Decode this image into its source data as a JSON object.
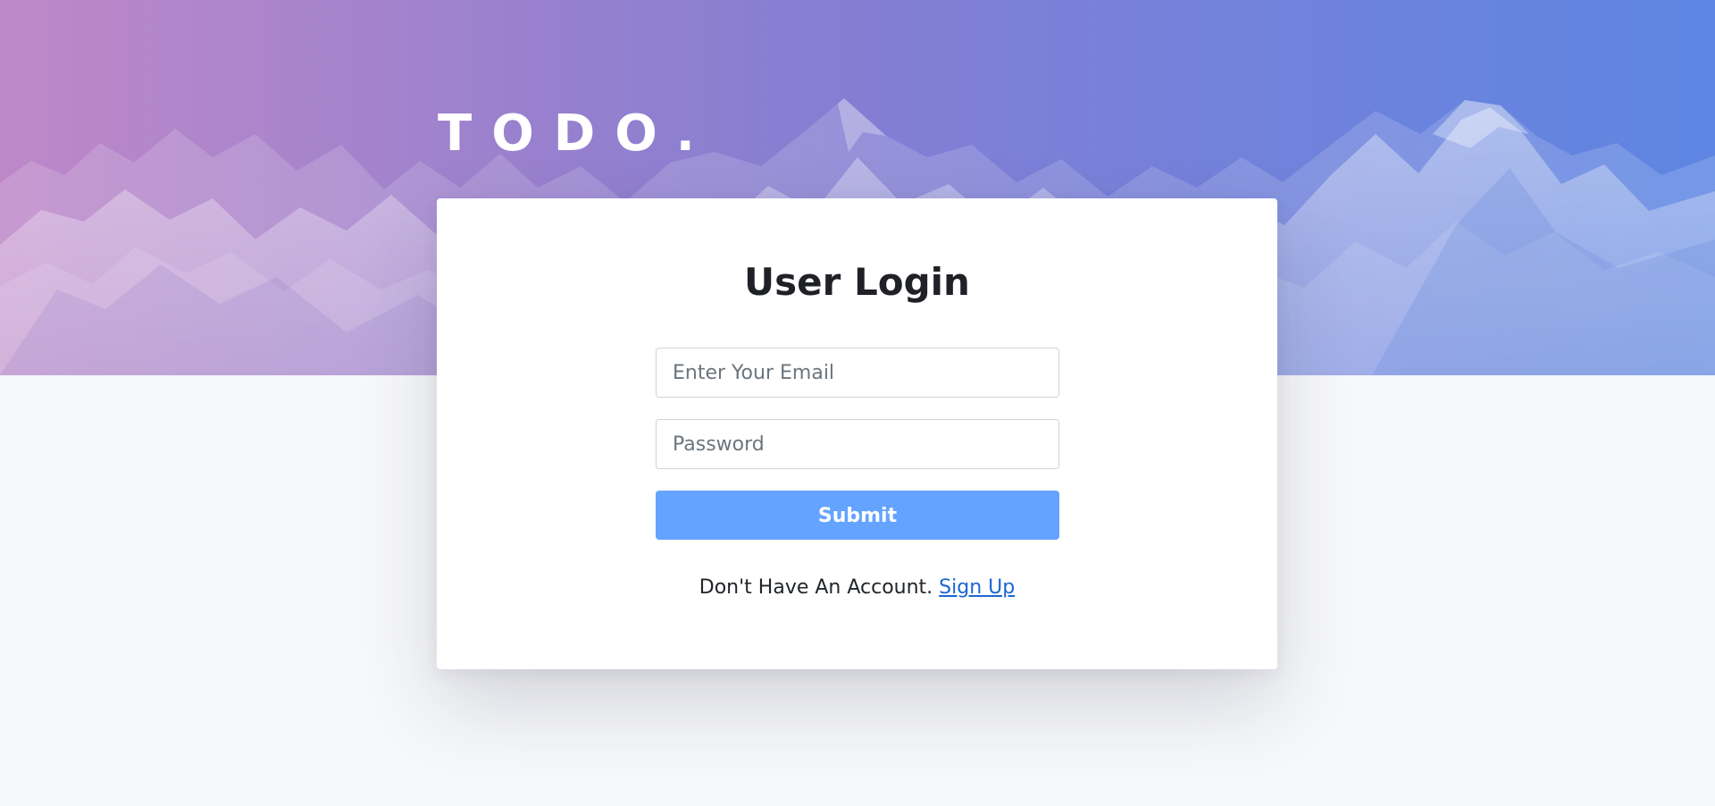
{
  "brand": {
    "logo": "TODO."
  },
  "login": {
    "title": "User Login",
    "email_placeholder": "Enter Your Email",
    "password_placeholder": "Password",
    "submit_label": "Submit",
    "signup_prompt": "Don't Have An Account.",
    "signup_link": "Sign Up"
  },
  "colors": {
    "hero_gradient_start": "#b77bc2",
    "hero_gradient_end": "#4f7be0",
    "page_background": "#f7f8fa",
    "submit_button": "#64a3ff",
    "link": "#1b66d2"
  }
}
